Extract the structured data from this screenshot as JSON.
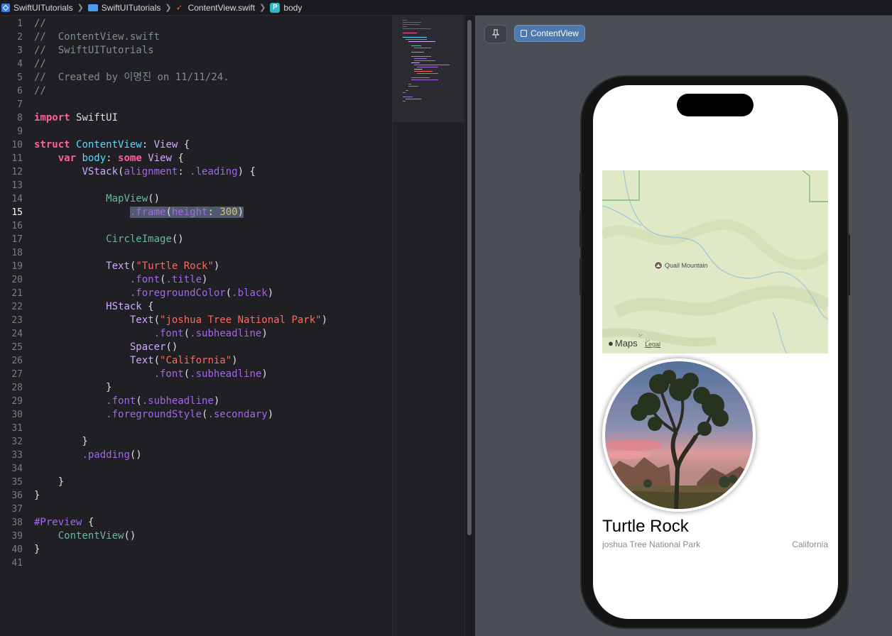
{
  "breadcrumb": {
    "project": "SwiftUITutorials",
    "folder": "SwiftUITutorials",
    "file": "ContentView.swift",
    "symbol_badge": "P",
    "symbol": "body"
  },
  "editor": {
    "current_line": 15,
    "lines": [
      {
        "n": "1"
      },
      {
        "n": "2"
      },
      {
        "n": "3"
      },
      {
        "n": "4"
      },
      {
        "n": "5"
      },
      {
        "n": "6"
      },
      {
        "n": "7"
      },
      {
        "n": "8"
      },
      {
        "n": "9"
      },
      {
        "n": "10"
      },
      {
        "n": "11"
      },
      {
        "n": "12"
      },
      {
        "n": "13"
      },
      {
        "n": "14"
      },
      {
        "n": "15"
      },
      {
        "n": "16"
      },
      {
        "n": "17"
      },
      {
        "n": "18"
      },
      {
        "n": "19"
      },
      {
        "n": "20"
      },
      {
        "n": "21"
      },
      {
        "n": "22"
      },
      {
        "n": "23"
      },
      {
        "n": "24"
      },
      {
        "n": "25"
      },
      {
        "n": "26"
      },
      {
        "n": "27"
      },
      {
        "n": "28"
      },
      {
        "n": "29"
      },
      {
        "n": "30"
      },
      {
        "n": "31"
      },
      {
        "n": "32"
      },
      {
        "n": "33"
      },
      {
        "n": "34"
      },
      {
        "n": "35"
      },
      {
        "n": "36"
      },
      {
        "n": "37"
      },
      {
        "n": "38"
      },
      {
        "n": "39"
      },
      {
        "n": "40"
      },
      {
        "n": "41"
      }
    ],
    "tokens": {
      "c1": "//",
      "c2": "//  ContentView.swift",
      "c3": "//  SwiftUITutorials",
      "c4": "//",
      "c5": "//  Created by 이명진 on 11/11/24.",
      "c6": "//",
      "import_kw": "import",
      "import_mod": "SwiftUI",
      "struct_kw": "struct",
      "struct_name": "ContentView",
      "colon_view": ": ",
      "view_type": "View",
      "open_brace": " {",
      "var_kw": "var",
      "body_name": "body",
      "colon": ": ",
      "some_kw": "some",
      "vstack": "VStack",
      "alignment": "alignment",
      "leading": ".leading",
      "mapview": "MapView",
      "frame": ".frame",
      "height": "height",
      "num300": "300",
      "circleimage": "CircleImage",
      "text": "Text",
      "str_turtle": "\"Turtle Rock\"",
      "font": ".font",
      "title": ".title",
      "fg_color": ".foregroundColor",
      "black": ".black",
      "hstack": "HStack",
      "str_joshua": "\"joshua Tree National Park\"",
      "subheadline": ".subheadline",
      "spacer": "Spacer",
      "str_california": "\"California\"",
      "fg_style": ".foregroundStyle",
      "secondary": ".secondary",
      "padding": ".padding",
      "preview": "#Preview",
      "contentview_call": "ContentView"
    }
  },
  "canvas": {
    "pin_icon_label": "pin-icon",
    "view_button_label": "ContentView",
    "map": {
      "poi_label": "Quail Mountain",
      "maps_label": "Maps",
      "legal_label": "Legal"
    },
    "landmark": {
      "title": "Turtle Rock",
      "park": "joshua Tree National Park",
      "state": "California"
    }
  },
  "colors": {
    "editor_bg": "#1f1f24",
    "canvas_bg": "#4a4e55",
    "keyword": "#fc5fa3",
    "string": "#fc6a5d",
    "number": "#d0bf69",
    "comment": "#7f8c98",
    "type": "#5dd8ff",
    "accent_button": "#4f78ad"
  }
}
